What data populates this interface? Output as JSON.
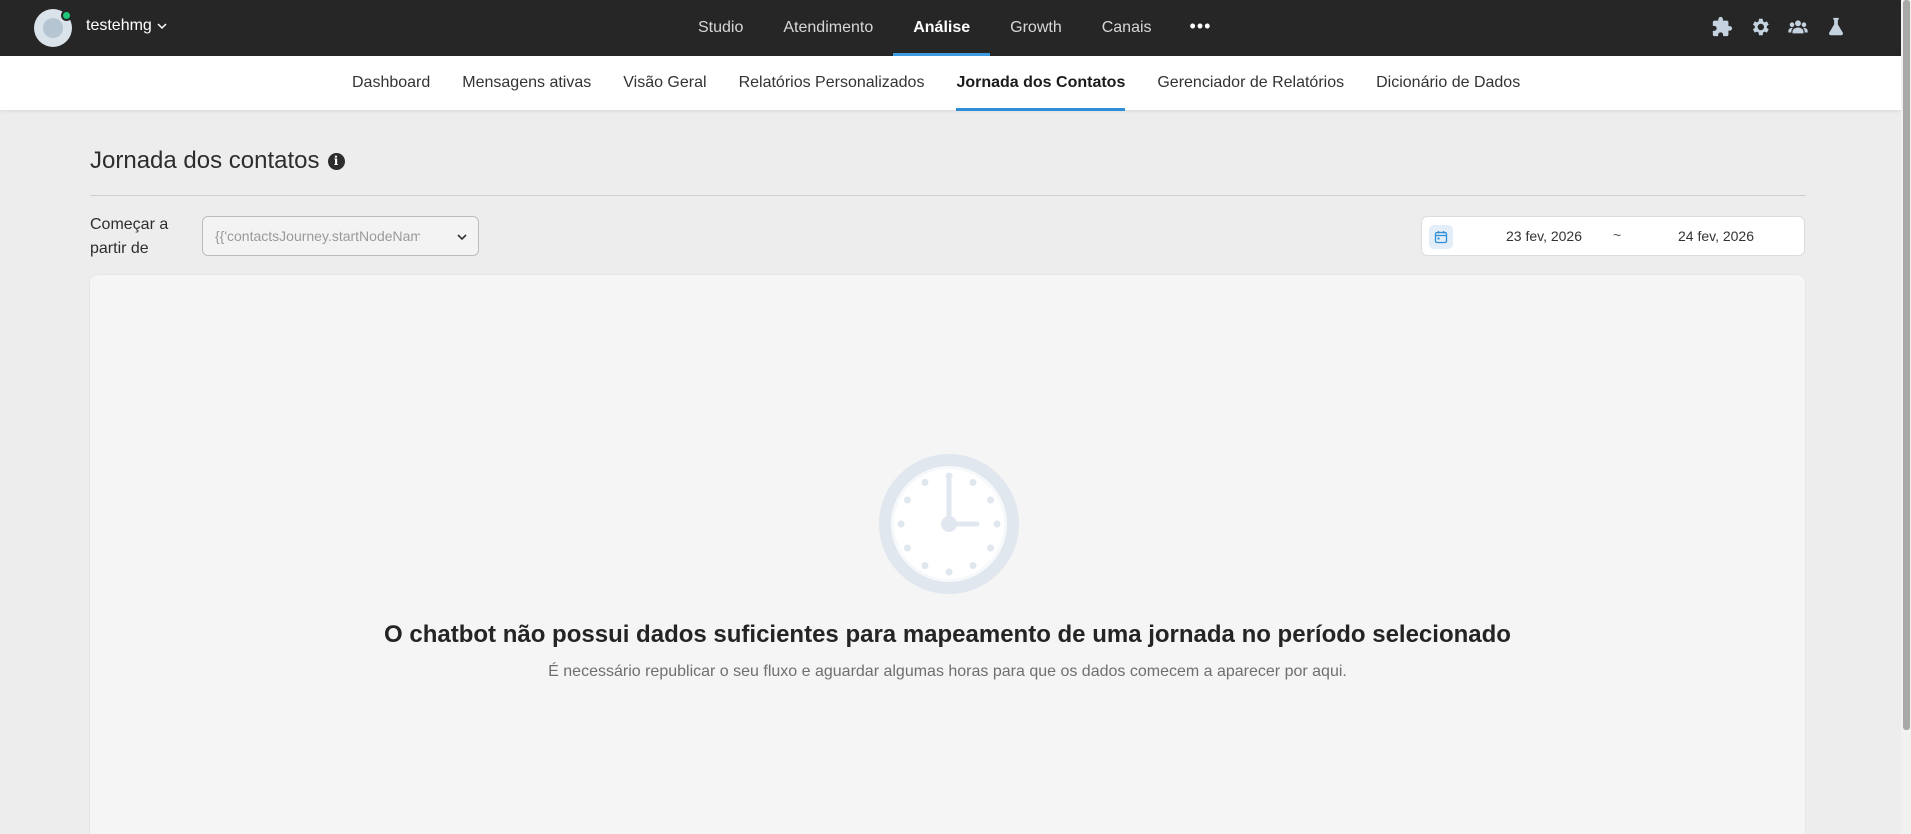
{
  "account": {
    "name": "testehmg"
  },
  "main_nav": {
    "items": [
      {
        "label": "Studio",
        "active": false
      },
      {
        "label": "Atendimento",
        "active": false
      },
      {
        "label": "Análise",
        "active": true
      },
      {
        "label": "Growth",
        "active": false
      },
      {
        "label": "Canais",
        "active": false
      }
    ],
    "more_label": "•••"
  },
  "tool_icons": [
    "puzzle-icon",
    "gear-icon",
    "team-icon",
    "flask-icon"
  ],
  "sub_nav": {
    "items": [
      {
        "label": "Dashboard",
        "active": false
      },
      {
        "label": "Mensagens ativas",
        "active": false
      },
      {
        "label": "Visão Geral",
        "active": false
      },
      {
        "label": "Relatórios Personalizados",
        "active": false
      },
      {
        "label": "Jornada dos Contatos",
        "active": true
      },
      {
        "label": "Gerenciador de Relatórios",
        "active": false
      },
      {
        "label": "Dicionário de Dados",
        "active": false
      }
    ]
  },
  "page": {
    "title": "Jornada dos contatos",
    "info_icon": "i"
  },
  "filters": {
    "start_label": "Começar a partir de",
    "start_select_value": "{{'contactsJourney.startNodeName'",
    "date_start": "23 fev, 2026",
    "date_separator": "~",
    "date_end": "24 fev, 2026"
  },
  "empty_state": {
    "icon": "clock-icon",
    "title": "O chatbot não possui dados suficientes para mapeamento de uma jornada no período selecionado",
    "description": "É necessário republicar o seu fluxo e aguardar algumas horas para que os dados comecem a aparecer por aqui."
  },
  "colors": {
    "topbar_bg": "#262626",
    "accent": "#2f8ed8",
    "online": "#1fc77b",
    "page_bg": "#ededed"
  }
}
